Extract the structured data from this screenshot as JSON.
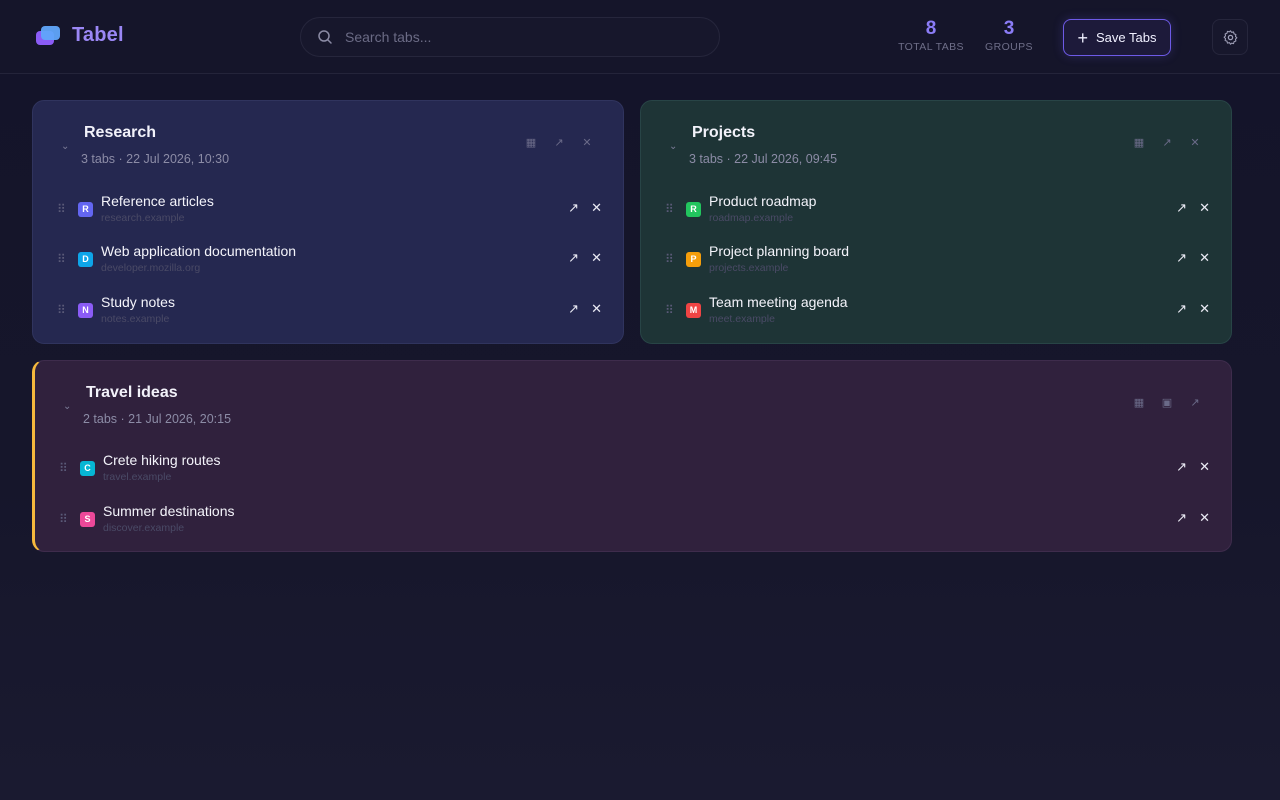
{
  "header": {
    "app_name": "Tabel",
    "search": {
      "placeholder": "Search tabs...",
      "value": ""
    },
    "stats": [
      {
        "value": "8",
        "label": "TOTAL TABS"
      },
      {
        "value": "3",
        "label": "GROUPS"
      }
    ],
    "save_button": "Save Tabs",
    "settings_icon": "gear-icon"
  },
  "colors": {
    "accent": "#8b5cf6",
    "research_bg": "#252850",
    "projects_bg": "#1e3436",
    "travel_bg": "#30213d",
    "travel_marker": "#f5b83d"
  },
  "groups": [
    {
      "title": "Research",
      "meta": "3 tabs · 22 Jul 2026, 10:30",
      "tabs": [
        {
          "letter": "R",
          "color": "#6366f1",
          "title": "Reference articles",
          "url": "research.example"
        },
        {
          "letter": "D",
          "color": "#0ea5e9",
          "title": "Web application documentation",
          "url": "developer.mozilla.org"
        },
        {
          "letter": "N",
          "color": "#8b5cf6",
          "title": "Study notes",
          "url": "notes.example"
        }
      ]
    },
    {
      "title": "Projects",
      "meta": "3 tabs · 22 Jul 2026, 09:45",
      "tabs": [
        {
          "letter": "R",
          "color": "#22c55e",
          "title": "Product roadmap",
          "url": "roadmap.example"
        },
        {
          "letter": "P",
          "color": "#f59e0b",
          "title": "Project planning board",
          "url": "projects.example"
        },
        {
          "letter": "M",
          "color": "#ef4444",
          "title": "Team meeting agenda",
          "url": "meet.example"
        }
      ]
    },
    {
      "title": "Travel ideas",
      "meta": "2 tabs · 21 Jul 2026, 20:15",
      "tabs": [
        {
          "letter": "C",
          "color": "#06b6d4",
          "title": "Crete hiking routes",
          "url": "travel.example"
        },
        {
          "letter": "S",
          "color": "#ec4899",
          "title": "Summer destinations",
          "url": "discover.example"
        }
      ]
    }
  ]
}
